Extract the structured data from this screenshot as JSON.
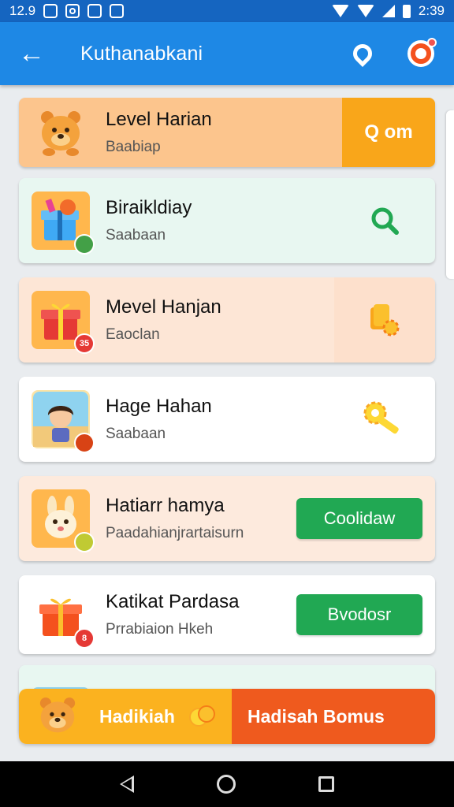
{
  "status_bar": {
    "time_left": "12.9",
    "time_right": "2:39"
  },
  "app_bar": {
    "title": "Kuthanabkani"
  },
  "cards": [
    {
      "title": "Level Harian",
      "subtitle": "Baabiap",
      "action_label": "Q om",
      "badge": ""
    },
    {
      "title": "Biraikldiay",
      "subtitle": "Saabaan",
      "action_label": "",
      "badge": ""
    },
    {
      "title": "Mevel Hanjan",
      "subtitle": "Eaoclan",
      "action_label": "",
      "badge": "35"
    },
    {
      "title": "Hage Hahan",
      "subtitle": "Saabaan",
      "action_label": "",
      "badge": ""
    },
    {
      "title": "Hatiarr hamya",
      "subtitle": "Paadahianjrartaisurn",
      "action_label": "Coolidaw",
      "badge": ""
    },
    {
      "title": "Katikat Pardasa",
      "subtitle": "Prrabiaion Hkeh",
      "action_label": "Bvodosr",
      "badge": "8"
    }
  ],
  "banner": {
    "left_label": "Hadikiah",
    "right_label": "Hadisah Bomus"
  },
  "colors": {
    "app_bar": "#1e88e5",
    "status_bar": "#1565c0",
    "accent_orange": "#f9a61a",
    "banner_red": "#ef5a1e",
    "button_green": "#21a853"
  }
}
